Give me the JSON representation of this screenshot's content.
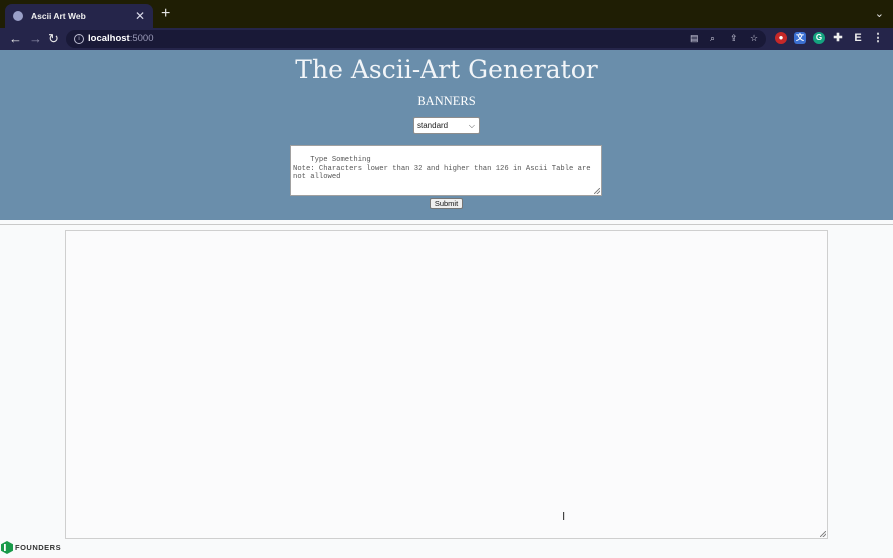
{
  "browser": {
    "tab_title": "Ascii Art Web",
    "tab_close": "✕",
    "new_tab": "+",
    "tab_menu": "⌄",
    "url_host": "localhost",
    "url_port": ":5000",
    "nav": {
      "back": "←",
      "forward": "→",
      "reload": "↻"
    },
    "icons": [
      "translate-icon",
      "zoom-icon",
      "share-icon",
      "bookmark-star-icon",
      "extension-icon"
    ]
  },
  "page": {
    "title": "The Ascii-Art Generator",
    "subtitle": "BANNERS",
    "banner_select": {
      "value": "standard"
    },
    "input": {
      "placeholder": "Type Something\nNote: Characters lower than 32 and higher than 126 in Ascii Table are not allowed"
    },
    "submit_label": "Submit",
    "output": ""
  },
  "footer": {
    "brand": "FOUNDERS"
  },
  "colors": {
    "hero_bg": "#6a8eab",
    "tabstrip_bg": "#1f1e04",
    "toolbar_bg": "#25254a",
    "page_bg": "#f9fafb"
  }
}
